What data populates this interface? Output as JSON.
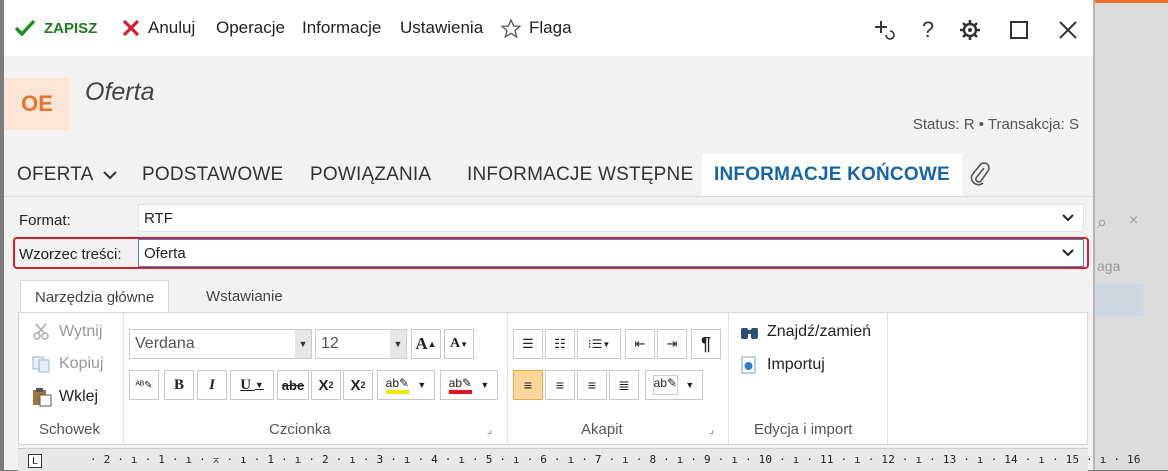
{
  "toolbar": {
    "save": "ZAPISZ",
    "cancel": "Anuluj",
    "operations": "Operacje",
    "information": "Informacje",
    "settings": "Ustawienia",
    "flag": "Flaga"
  },
  "header": {
    "badge": "OE",
    "title": "Oferta",
    "status": "Status:  R  •  Transakcja:  S"
  },
  "tabs": [
    "OFERTA",
    "PODSTAWOWE",
    "POWIĄZANIA",
    "INFORMACJE WSTĘPNE",
    "INFORMACJE KOŃCOWE"
  ],
  "form": {
    "format_label": "Format:",
    "format_value": "RTF",
    "template_label": "Wzorzec treści:",
    "template_value": "Oferta"
  },
  "ribbon": {
    "tabs": [
      "Narzędzia główne",
      "Wstawianie"
    ],
    "clipboard": {
      "cut": "Wytnij",
      "copy": "Kopiuj",
      "paste": "Wklej",
      "label": "Schowek"
    },
    "font": {
      "family": "Verdana",
      "size": "12",
      "label": "Czcionka"
    },
    "paragraph": {
      "label": "Akapit"
    },
    "edit": {
      "find": "Znajdź/zamień",
      "import": "Importuj",
      "label": "Edycja i import"
    }
  },
  "ruler": {
    "text": "· 2 · ı · 1 · ı · ⌅ · ı · 1 · ı · 2 · ı · 3 · ı · 4 · ı · 5 · ı · 6 · ı · 7 · ı · 8 · ı · 9 · ı · 10 · ı · 11 · ı · 12 · ı · 13 · ı · 14 · ı · 15 · ı · 16"
  },
  "colors": {
    "accent": "#e8732a",
    "active_tab": "#1565a8",
    "highlight_border": "#d4202a",
    "save_green": "#1f7a1f"
  }
}
